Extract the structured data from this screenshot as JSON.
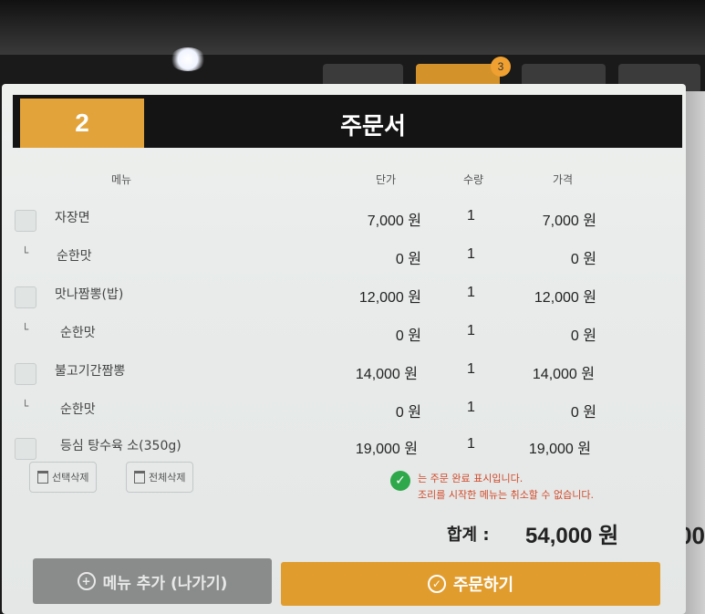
{
  "top_bar": {
    "cart_count": "3"
  },
  "side_peek_text": "00",
  "header": {
    "order_number": "2",
    "title": "주문서"
  },
  "columns": {
    "menu": "메뉴",
    "unit_price": "단가",
    "quantity": "수량",
    "price": "가격"
  },
  "items": [
    {
      "type": "main",
      "name": "자장면",
      "unit_price": "7,000 원",
      "quantity": "1",
      "price": "7,000 원"
    },
    {
      "type": "sub",
      "mark": "└",
      "name": "순한맛",
      "unit_price": "0 원",
      "quantity": "1",
      "price": "0 원"
    },
    {
      "type": "main",
      "name": "맛나짬뽕(밥)",
      "unit_price": "12,000 원",
      "quantity": "1",
      "price": "12,000 원"
    },
    {
      "type": "sub",
      "mark": "└",
      "name": "순한맛",
      "unit_price": "0 원",
      "quantity": "1",
      "price": "0 원"
    },
    {
      "type": "main",
      "name": "불고기간짬뽕",
      "unit_price": "14,000 원",
      "quantity": "1",
      "price": "14,000 원"
    },
    {
      "type": "sub",
      "mark": "└",
      "name": "순한맛",
      "unit_price": "0 원",
      "quantity": "1",
      "price": "0 원"
    },
    {
      "type": "main",
      "name": "등심 탕수육 소(350g)",
      "unit_price": "19,000 원",
      "quantity": "1",
      "price": "19,000 원"
    }
  ],
  "actions": {
    "delete_selected": "선택삭제",
    "delete_all": "전체삭제"
  },
  "notice": {
    "line1": "는 주문 완료 표시입니다.",
    "line2": "조리를 시작한 메뉴는 취소할 수 없습니다."
  },
  "total": {
    "label": "합계 :",
    "value": "54,000 원"
  },
  "buttons": {
    "add_menu": "메뉴 추가 (나가기)",
    "order": "주문하기"
  },
  "colors": {
    "accent": "#e19c2e",
    "header_bg": "#141414",
    "notice_text": "#d04a2a",
    "complete_icon": "#2ea84a"
  }
}
